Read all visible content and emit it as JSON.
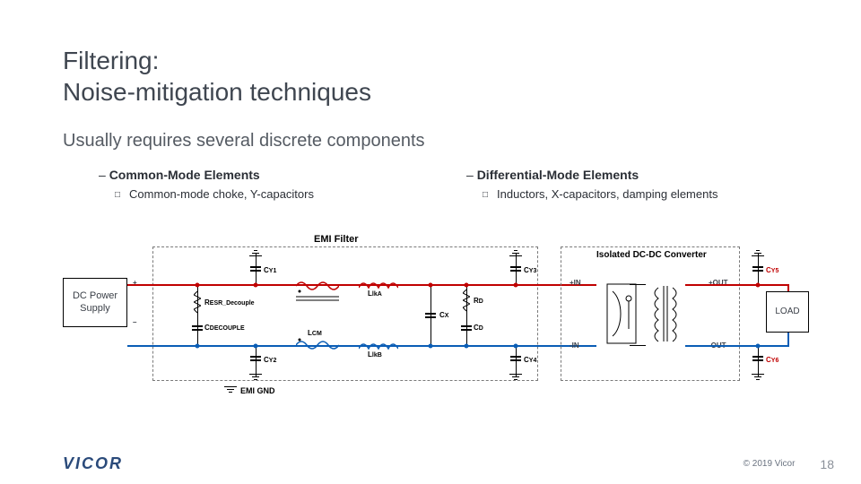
{
  "title_line1": "Filtering:",
  "title_line2": "Noise-mitigation techniques",
  "subtitle": "Usually requires several discrete components",
  "columns": {
    "left": {
      "head": "Common-Mode Elements",
      "item": "Common-mode choke, Y-capacitors"
    },
    "right": {
      "head": "Differential-Mode Elements",
      "item": "Inductors, X-capacitors, damping elements"
    }
  },
  "diagram": {
    "emi_filter": "EMI Filter",
    "iso_conv": "Isolated DC-DC Converter",
    "dc_supply": "DC Power Supply",
    "load": "LOAD",
    "emi_gnd": "EMI GND",
    "pins": {
      "pin": "+IN",
      "nin": "-IN",
      "pout": "+OUT",
      "nout": "-OUT"
    },
    "plus": "+",
    "minus": "–",
    "labels": {
      "cy1": "C",
      "cy1s": "Y1",
      "cy2": "C",
      "cy2s": "Y2",
      "cy3": "C",
      "cy3s": "Y3",
      "cy4": "C",
      "cy4s": "Y4",
      "cy5": "C",
      "cy5s": "Y5",
      "cy6": "C",
      "cy6s": "Y6",
      "resb": "R",
      "resbs": "ESR_Decouple",
      "cdec": "C",
      "cdecs": "DECOUPLE",
      "lcm": "L",
      "lcms": "CM",
      "llka": "L",
      "llkas": "lkA",
      "llkb": "L",
      "llkbs": "lkB",
      "cx": "C",
      "cxs": "X",
      "rd": "R",
      "rds": "D",
      "cd": "C",
      "cds": "D"
    }
  },
  "footer": {
    "logo": "VICOR",
    "copyright": "© 2019 Vicor",
    "page": "18"
  }
}
